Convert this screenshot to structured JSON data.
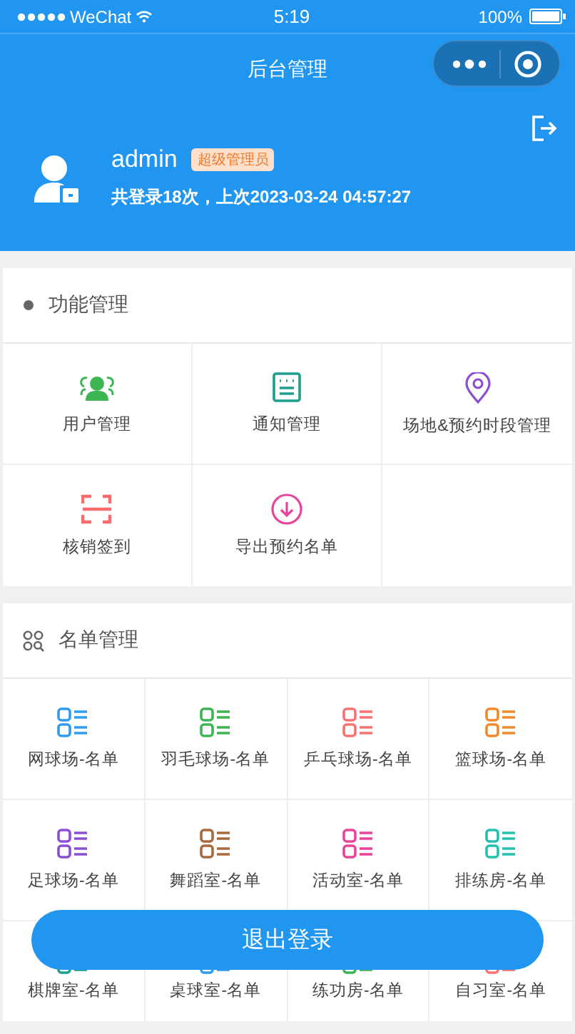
{
  "status_bar": {
    "carrier": "WeChat",
    "time": "5:19",
    "battery": "100%"
  },
  "nav": {
    "title": "后台管理"
  },
  "profile": {
    "name": "admin",
    "badge": "超级管理员",
    "info": "共登录18次，上次2023-03-24 04:57:27"
  },
  "function_section": {
    "title": "功能管理",
    "items": [
      {
        "label": "用户管理",
        "kind": "users",
        "color": "#3cb552"
      },
      {
        "label": "通知管理",
        "kind": "notice",
        "color": "#1f9d8f"
      },
      {
        "label": "场地&预约时段管理",
        "kind": "location",
        "color": "#8a4fd3"
      },
      {
        "label": "核销签到",
        "kind": "scan",
        "color": "#fa6b6b"
      },
      {
        "label": "导出预约名单",
        "kind": "download",
        "color": "#e8459a"
      }
    ]
  },
  "list_section": {
    "title": "名单管理",
    "items": [
      {
        "label": "网球场-名单",
        "color": "#2f9cf0"
      },
      {
        "label": "羽毛球场-名单",
        "color": "#3cb552"
      },
      {
        "label": "乒乓球场-名单",
        "color": "#f77272"
      },
      {
        "label": "篮球场-名单",
        "color": "#f08a2c"
      },
      {
        "label": "足球场-名单",
        "color": "#8a4fd3"
      },
      {
        "label": "舞蹈室-名单",
        "color": "#a8693c"
      },
      {
        "label": "活动室-名单",
        "color": "#e8459a"
      },
      {
        "label": "排练房-名单",
        "color": "#22c1b0"
      },
      {
        "label": "棋牌室-名单",
        "color": "#1f9d8f"
      },
      {
        "label": "桌球室-名单",
        "color": "#2f9cf0"
      },
      {
        "label": "练功房-名单",
        "color": "#3cb552"
      },
      {
        "label": "自习室-名单",
        "color": "#f77272"
      }
    ]
  },
  "logout_button": {
    "label": "退出登录"
  }
}
